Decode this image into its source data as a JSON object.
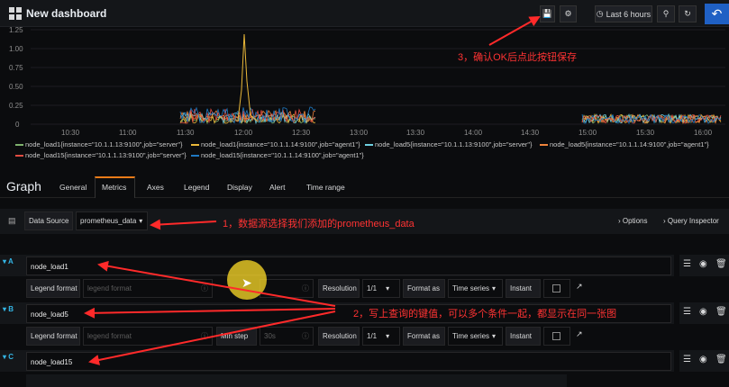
{
  "header": {
    "title": "New dashboard",
    "time_range": "Last 6 hours"
  },
  "chart_data": {
    "type": "line",
    "y_ticks": [
      "1.25",
      "1.00",
      "0.75",
      "0.50",
      "0.25",
      "0"
    ],
    "x_ticks": [
      "10:30",
      "11:00",
      "11:30",
      "12:00",
      "12:30",
      "13:00",
      "13:30",
      "14:00",
      "14:30",
      "15:00",
      "15:30",
      "16:00"
    ],
    "ylim": [
      0,
      1.25
    ],
    "series": [
      {
        "name": "node_load1{instance=\"10.1.1.13:9100\",job=\"server\"}",
        "color": "#7eb26d",
        "values": []
      },
      {
        "name": "node_load1{instance=\"10.1.1.14:9100\",job=\"agent1\"}",
        "color": "#eab839",
        "values": []
      },
      {
        "name": "node_load5{instance=\"10.1.1.13:9100\",job=\"server\"}",
        "color": "#6ed0e0",
        "values": []
      },
      {
        "name": "node_load5{instance=\"10.1.1.14:9100\",job=\"agent1\"}",
        "color": "#ef843c",
        "values": []
      },
      {
        "name": "node_load15{instance=\"10.1.1.13:9100\",job=\"server\"}",
        "color": "#e24d42",
        "values": []
      },
      {
        "name": "node_load15{instance=\"10.1.1.14:9100\",job=\"agent1\"}",
        "color": "#1f78c1",
        "values": []
      }
    ]
  },
  "editor": {
    "title": "Graph",
    "tabs": [
      "General",
      "Metrics",
      "Axes",
      "Legend",
      "Display",
      "Alert",
      "Time range"
    ],
    "data_source_label": "Data Source",
    "data_source_value": "prometheus_data",
    "options": "Options",
    "query_inspector": "Query Inspector",
    "queries": [
      {
        "letter": "A",
        "expr": "node_load1"
      },
      {
        "letter": "B",
        "expr": "node_load5"
      },
      {
        "letter": "C",
        "expr": "node_load15"
      }
    ],
    "legend_format_label": "Legend format",
    "legend_format_placeholder": "legend format",
    "min_step_label": "Min step",
    "min_step_placeholder": "30s",
    "resolution_label": "Resolution",
    "resolution_value": "1/1",
    "format_as_label": "Format as",
    "format_as_value": "Time series",
    "instant_label": "Instant"
  },
  "annotations": {
    "a1": "1，数据源选择我们添加的prometheus_data",
    "a2": "2，写上查询的键值，可以多个条件一起，都显示在同一张图",
    "a3": "3，确认OK后点此按钮保存"
  }
}
